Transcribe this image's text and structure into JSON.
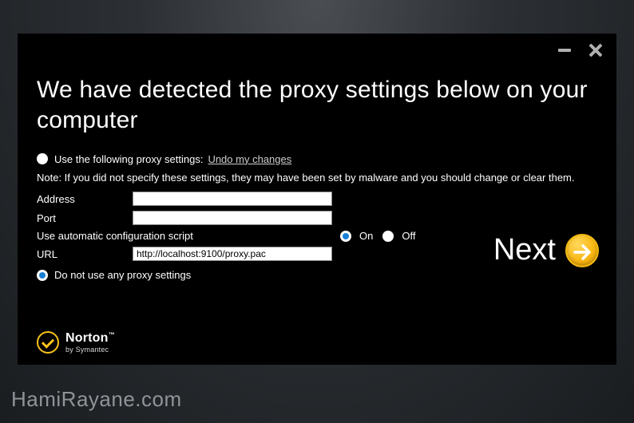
{
  "title": "We have detected the proxy settings below on your computer",
  "proxy_section": {
    "use_following_label": "Use the following proxy settings:",
    "undo_link": "Undo my changes",
    "note": "Note: If you did not specify these settings, they may have been set by malware and you should change or clear them.",
    "address_label": "Address",
    "address_value": "",
    "port_label": "Port",
    "port_value": "",
    "script_label": "Use automatic configuration script",
    "on_label": "On",
    "off_label": "Off",
    "url_label": "URL",
    "url_value": "http://localhost:9100/proxy.pac",
    "do_not_use_label": "Do not use any proxy settings"
  },
  "next_label": "Next",
  "brand": {
    "name": "Norton",
    "byline": "by Symantec"
  },
  "watermark": "HamiRayane.com"
}
